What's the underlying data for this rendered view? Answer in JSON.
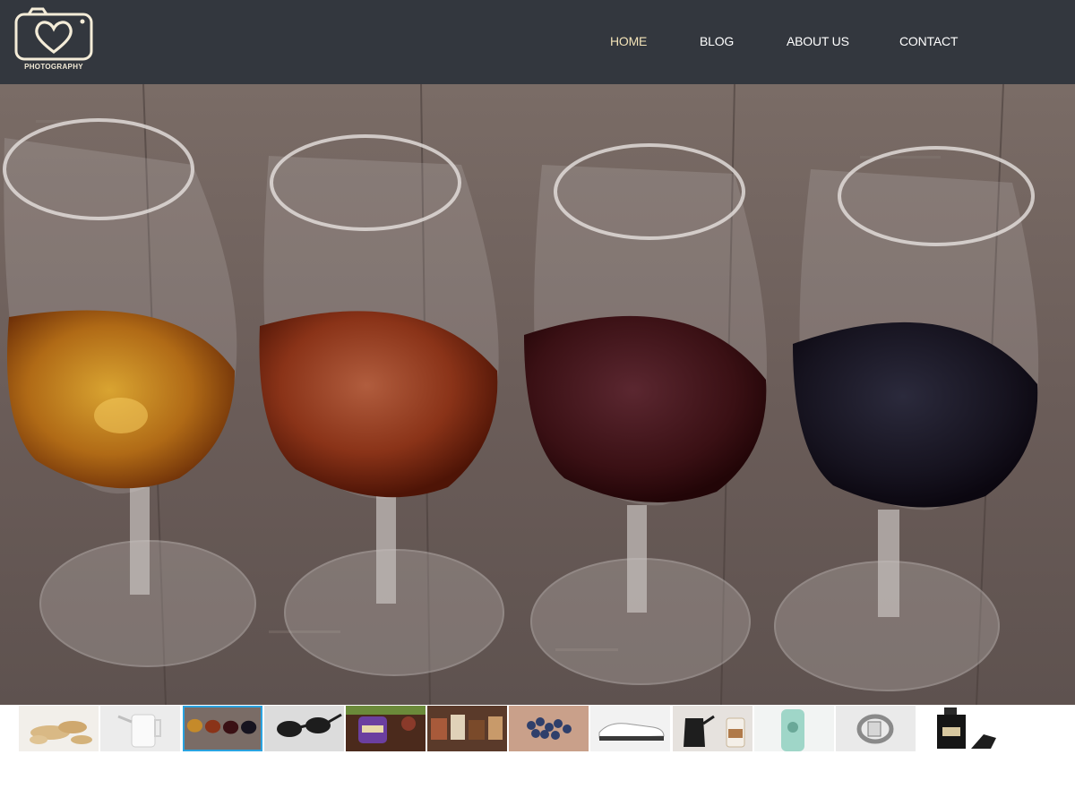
{
  "header": {
    "logo_text": "PHOTOGRAPHY",
    "nav": {
      "home": "HOME",
      "blog": "BLOG",
      "about": "ABOUT US",
      "contact": "CONTACT"
    },
    "active": "home"
  },
  "hero": {
    "image": "four-wine-glasses-on-wooden-table"
  },
  "thumbnails": {
    "selected_index": 2,
    "items": [
      "ginger-root",
      "white-kettle",
      "wine-glasses",
      "sunglasses",
      "purple-product-jar",
      "market-stall",
      "blueberries-in-hands",
      "sneaker",
      "coffee-kettle-cup",
      "mint-bottle",
      "bracelet",
      "perfume-bottle"
    ]
  },
  "colors": {
    "header_bg": "#33373e",
    "nav_active": "#f3e3b8",
    "nav_text": "#ffffff",
    "selected_border": "#2aa3e0"
  }
}
